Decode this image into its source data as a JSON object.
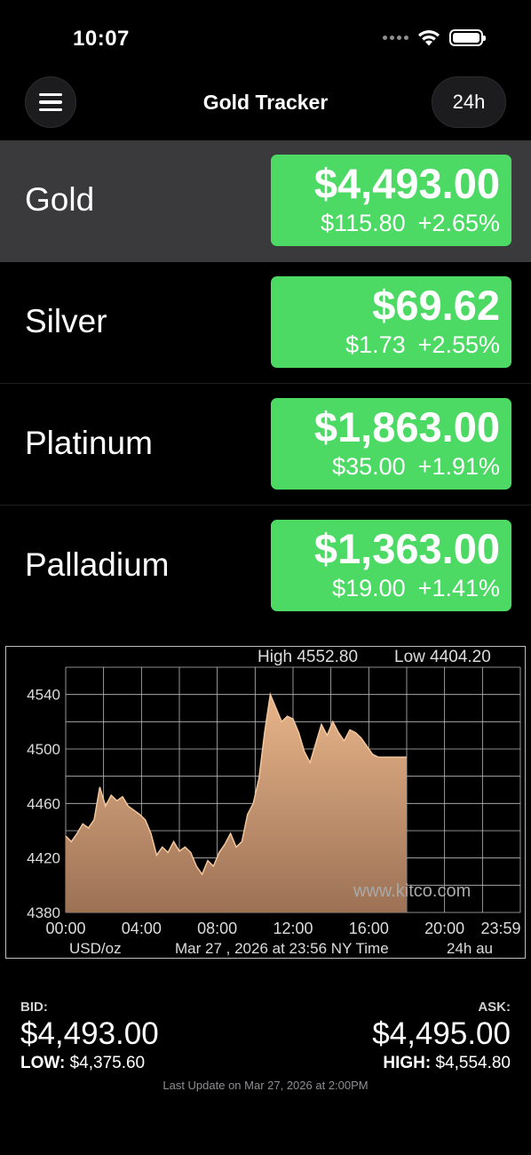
{
  "status_bar": {
    "time": "10:07",
    "icons": [
      "signal-icon",
      "wifi-icon",
      "battery-icon"
    ]
  },
  "nav": {
    "title": "Gold Tracker",
    "range_label": "24h",
    "menu_icon": "menu-icon"
  },
  "metals": [
    {
      "name": "Gold",
      "price": "$4,493.00",
      "change": "$115.80",
      "percent": "+2.65%",
      "selected": true
    },
    {
      "name": "Silver",
      "price": "$69.62",
      "change": "$1.73",
      "percent": "+2.55%",
      "selected": false
    },
    {
      "name": "Platinum",
      "price": "$1,863.00",
      "change": "$35.00",
      "percent": "+1.91%",
      "selected": false
    },
    {
      "name": "Palladium",
      "price": "$1,363.00",
      "change": "$19.00",
      "percent": "+1.41%",
      "selected": false
    }
  ],
  "colors": {
    "up": "#4cd964",
    "selected_row": "#3a3a3c",
    "chart_fill": "#d9a57c",
    "chart_line": "#f3c79b"
  },
  "chart_data": {
    "type": "area",
    "high_label": "High 4552.80",
    "low_label": "Low 4404.20",
    "y_ticks": [
      "4540",
      "4500",
      "4460",
      "4420",
      "4380"
    ],
    "ylim": [
      4380,
      4560
    ],
    "x_ticks": [
      "00:00",
      "04:00",
      "08:00",
      "12:00",
      "16:00",
      "20:00",
      "23:59"
    ],
    "xlim": [
      0,
      24
    ],
    "unit_label": "USD/oz",
    "date_label": "Mar 27 , 2026 at 23:56 NY Time",
    "range_label": "24h au",
    "watermark": "www.kitco.com",
    "grid": true,
    "series": [
      {
        "x": [
          0.0,
          0.3,
          0.6,
          0.9,
          1.2,
          1.5,
          1.8,
          2.1,
          2.4,
          2.7,
          3.0,
          3.3,
          3.6,
          3.9,
          4.2,
          4.5,
          4.8,
          5.1,
          5.4,
          5.7,
          6.0,
          6.3,
          6.6,
          6.9,
          7.2,
          7.5,
          7.8,
          8.1,
          8.4,
          8.7,
          9.0,
          9.3,
          9.6,
          9.9,
          10.2,
          10.5,
          10.8,
          11.1,
          11.4,
          11.7,
          12.0,
          12.3,
          12.6,
          12.9,
          13.2,
          13.5,
          13.8,
          14.1,
          14.4,
          14.7,
          15.0,
          15.3,
          15.6,
          15.9,
          16.2,
          16.5,
          16.8,
          17.1,
          17.4,
          17.7,
          18.0
        ],
        "y": [
          4436,
          4432,
          4438,
          4445,
          4442,
          4448,
          4472,
          4458,
          4466,
          4462,
          4465,
          4458,
          4455,
          4452,
          4448,
          4438,
          4422,
          4428,
          4424,
          4432,
          4425,
          4428,
          4424,
          4414,
          4408,
          4418,
          4414,
          4424,
          4430,
          4438,
          4428,
          4432,
          4452,
          4460,
          4478,
          4512,
          4540,
          4530,
          4520,
          4524,
          4522,
          4512,
          4498,
          4490,
          4504,
          4518,
          4510,
          4520,
          4512,
          4506,
          4514,
          4512,
          4508,
          4502,
          4496,
          4494,
          4494,
          4494,
          4494,
          4494,
          4494
        ]
      }
    ]
  },
  "quote": {
    "bid_label": "BID:",
    "bid": "$4,493.00",
    "low_label": "LOW:",
    "low": "$4,375.60",
    "ask_label": "ASK:",
    "ask": "$4,495.00",
    "high_label": "HIGH:",
    "high": "$4,554.80",
    "last_update": "Last Update on Mar 27, 2026 at 2:00PM"
  }
}
